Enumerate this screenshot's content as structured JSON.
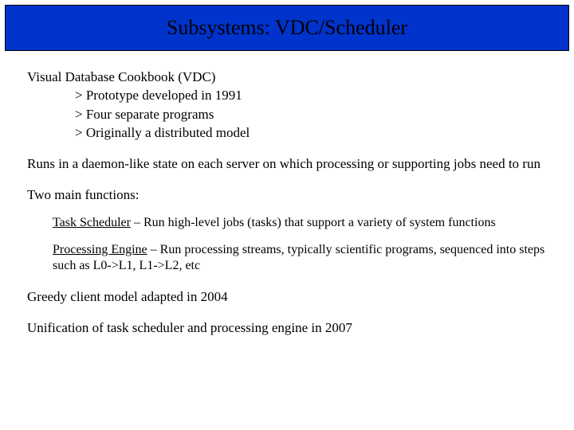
{
  "title": "Subsystems: VDC/Scheduler",
  "vdc": {
    "heading": "Visual Database Cookbook (VDC)",
    "bullets": [
      "> Prototype developed in 1991",
      "> Four separate programs",
      "> Originally a distributed model"
    ]
  },
  "daemon_para": "Runs in a daemon-like state on each server on which processing or supporting jobs need to run",
  "two_main": "Two main functions:",
  "task_scheduler": {
    "label": "Task Scheduler",
    "desc": " – Run high-level jobs (tasks) that support a variety of system functions"
  },
  "processing_engine": {
    "label": "Processing Engine",
    "desc": " – Run processing streams, typically scientific programs, sequenced into steps such as L0->L1, L1->L2, etc"
  },
  "greedy": "Greedy client model adapted in 2004",
  "unification": "Unification of task scheduler and processing engine in 2007"
}
